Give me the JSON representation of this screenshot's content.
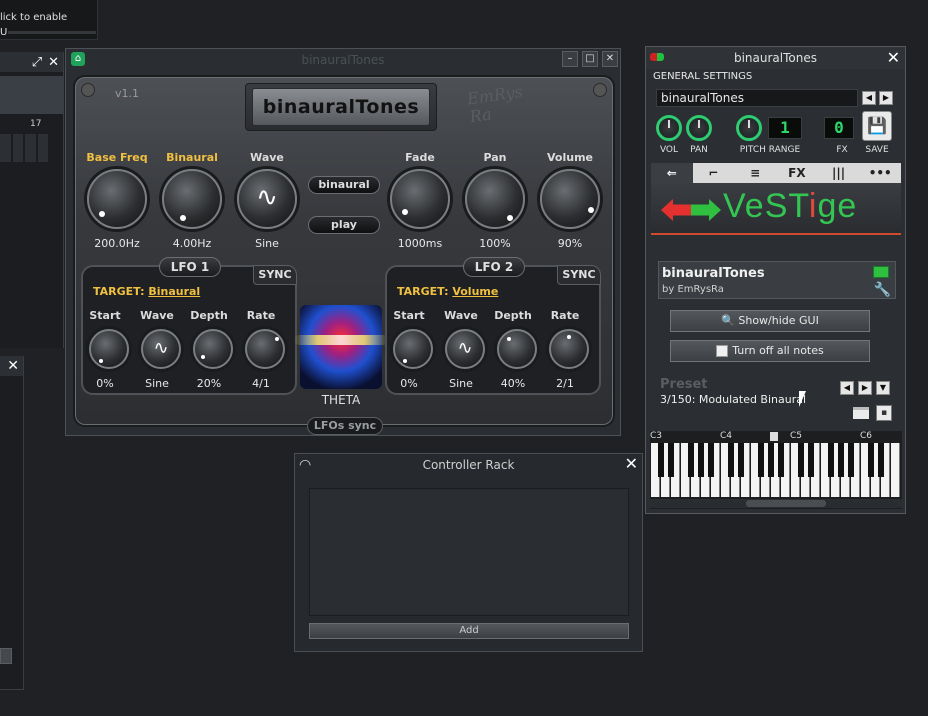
{
  "background": {
    "topleft_text1": "lick to enable",
    "topleft_text2": "U",
    "leftwin_bar": "17"
  },
  "plugin_window": {
    "title": "binauralTones",
    "version": "v1.1",
    "plugin_title": "binauralTones",
    "logo": "EmRys Ra",
    "knobs": [
      {
        "label": "Base Freq",
        "value": "200.0Hz"
      },
      {
        "label": "Binaural",
        "value": "4.00Hz"
      },
      {
        "label": "Wave",
        "value": "Sine"
      },
      {
        "label": "Fade",
        "value": "1000ms"
      },
      {
        "label": "Pan",
        "value": "100%"
      },
      {
        "label": "Volume",
        "value": "90%"
      }
    ],
    "buttons": {
      "binaural": "binaural",
      "play": "play"
    },
    "lfo1": {
      "title": "LFO 1",
      "sync": "SYNC",
      "target_label": "TARGET:",
      "target_value": "Binaural",
      "knobs": [
        {
          "label": "Start",
          "value": "0%"
        },
        {
          "label": "Wave",
          "value": "Sine"
        },
        {
          "label": "Depth",
          "value": "20%"
        },
        {
          "label": "Rate",
          "value": "4/1"
        }
      ]
    },
    "lfo2": {
      "title": "LFO 2",
      "sync": "SYNC",
      "target_label": "TARGET:",
      "target_value": "Volume",
      "knobs": [
        {
          "label": "Start",
          "value": "0%"
        },
        {
          "label": "Wave",
          "value": "Sine"
        },
        {
          "label": "Depth",
          "value": "40%"
        },
        {
          "label": "Rate",
          "value": "2/1"
        }
      ]
    },
    "theta": "THETA",
    "lfos_sync": "LFOs sync"
  },
  "controller_rack": {
    "title": "Controller Rack",
    "add_label": "Add"
  },
  "instrument_window": {
    "title": "binauralTones",
    "general_settings": "GENERAL SETTINGS",
    "name": "binauralTones",
    "vol_label": "VOL",
    "pan_label": "PAN",
    "pitch_range_label": "PITCH RANGE",
    "pitch_range_value": "1",
    "fx_label": "FX",
    "fx_value": "0",
    "save_label": "SAVE",
    "tabs": [
      "⇐",
      "⌐",
      "≡",
      "FX",
      "|||",
      "•••"
    ],
    "active_tab": 0,
    "vestige_name_a": "VeST",
    "vestige_name_b": "i",
    "vestige_name_c": "ge",
    "plugin_name": "binauralTones",
    "plugin_by": "by EmRysRa",
    "show_hide_gui": "Show/hide GUI",
    "turn_off_notes": "Turn off all notes",
    "preset_label": "Preset",
    "preset_value": "3/150: Modulated Binaural",
    "octaves": [
      "C3",
      "C4",
      "C5",
      "C6"
    ]
  },
  "colors": {
    "accent_green": "#2ecc71",
    "label_gold": "#f0c040",
    "vestige_red": "#e04a3a"
  }
}
